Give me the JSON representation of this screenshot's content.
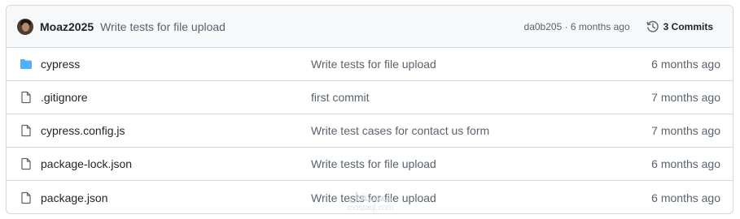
{
  "header": {
    "author": "Moaz2025",
    "message": "Write tests for file upload",
    "sha_age": "da0b205 · 6 months ago",
    "commits_label": "3 Commits",
    "avatar_icon": "avatar",
    "history_icon": "history-icon"
  },
  "files": [
    {
      "name": "cypress",
      "type": "folder",
      "message": "Write tests for file upload",
      "age": "6 months ago"
    },
    {
      "name": ".gitignore",
      "type": "file",
      "message": "first commit",
      "age": "7 months ago"
    },
    {
      "name": "cypress.config.js",
      "type": "file",
      "message": "Write test cases for contact us form",
      "age": "7 months ago"
    },
    {
      "name": "package-lock.json",
      "type": "file",
      "message": "Write tests for file upload",
      "age": "6 months ago"
    },
    {
      "name": "package.json",
      "type": "file",
      "message": "Write tests for file upload",
      "age": "6 months ago"
    }
  ],
  "watermark": {
    "arabic": "مستقل",
    "latin": "mostaql.com"
  },
  "colors": {
    "folder": "#54aeff",
    "header_bg": "#f6f8fa",
    "border": "#d1d9e0",
    "muted_text": "#59636e"
  }
}
